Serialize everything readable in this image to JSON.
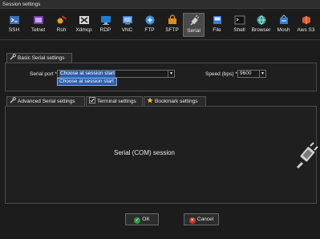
{
  "window": {
    "title": "Session settings"
  },
  "toolbar": {
    "items": [
      {
        "label": "SSH",
        "icon": "ssh-icon"
      },
      {
        "label": "Telnet",
        "icon": "telnet-icon"
      },
      {
        "label": "Rsh",
        "icon": "rsh-icon"
      },
      {
        "label": "Xdmcp",
        "icon": "xdmcp-icon"
      },
      {
        "label": "RDP",
        "icon": "rdp-icon"
      },
      {
        "label": "VNC",
        "icon": "vnc-icon"
      },
      {
        "label": "FTP",
        "icon": "ftp-icon"
      },
      {
        "label": "SFTP",
        "icon": "sftp-icon"
      },
      {
        "label": "Serial",
        "icon": "serial-plug-icon",
        "active": true
      },
      {
        "label": "File",
        "icon": "file-icon"
      },
      {
        "label": "Shell",
        "icon": "shell-icon"
      },
      {
        "label": "Browser",
        "icon": "browser-globe-icon"
      },
      {
        "label": "Mosh",
        "icon": "mosh-icon"
      },
      {
        "label": "Aws S3",
        "icon": "aws-s3-icon"
      }
    ]
  },
  "basic": {
    "tab_label": "Basic Serial settings",
    "serial_port_label": "Serial port *",
    "serial_port_value": "Choose at session start",
    "dropdown_option": "Choose at session start",
    "speed_label": "Speed (bps) *",
    "speed_value": "9600"
  },
  "advanced_tabs": {
    "advanced": "Advanced Serial settings",
    "terminal": "Terminal settings",
    "bookmark": "Bookmark settings"
  },
  "main": {
    "session_text": "Serial (COM) session"
  },
  "buttons": {
    "ok": "OK",
    "cancel": "Cancel"
  },
  "colors": {
    "ok_green": "#2e9a3c",
    "cancel_red": "#c0392b",
    "selection_blue": "#2d5ca8"
  }
}
